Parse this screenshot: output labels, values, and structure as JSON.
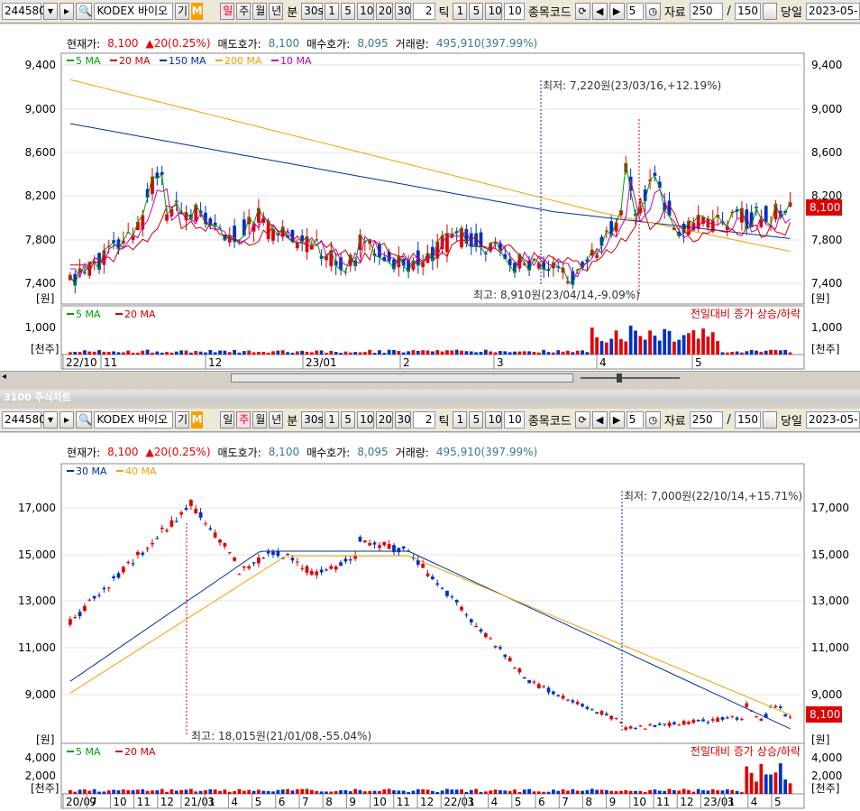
{
  "toolbar": {
    "code": "244580",
    "name": "KODEX 바이오",
    "gi_label": "기",
    "m_label": "M",
    "periods": [
      "일",
      "주",
      "월",
      "년",
      "분",
      "30s",
      "1",
      "5",
      "10",
      "20",
      "30"
    ],
    "tick_count": "2",
    "tick_label": "틱",
    "tick_opts": [
      "1",
      "5",
      "10"
    ],
    "tick_input": "10",
    "code_label": "종목코드",
    "step_value": "5",
    "data_label": "자료",
    "data_count": "250",
    "slash": "/",
    "total": "150",
    "today_label": "당일",
    "date": "2023-05-"
  },
  "info": {
    "price_label": "현재가:",
    "price": "8,100",
    "change": "▲20(0.25%)",
    "ask_label": "매도호가:",
    "ask": "8,100",
    "bid_label": "매수호가:",
    "bid": "8,095",
    "vol_label": "거래량:",
    "vol": "495,910(397.99%)"
  },
  "chart1": {
    "legend": [
      {
        "name": "5 MA",
        "color": "#00a000"
      },
      {
        "name": "20 MA",
        "color": "#d00000"
      },
      {
        "name": "150 MA",
        "color": "#0030a0"
      },
      {
        "name": "200 MA",
        "color": "#f0a000"
      },
      {
        "name": "10 MA",
        "color": "#c000c0"
      }
    ],
    "y_ticks": [
      "9,400",
      "9,000",
      "8,600",
      "8,200",
      "7,800",
      "7,400"
    ],
    "unit": "[원]",
    "low_note": "최저: 7,220원(23/03/16,+12.19%)",
    "high_note": "최고: 8,910원(23/04/14,-9.09%)",
    "price_tag": "8,100",
    "vol_legend": [
      {
        "name": "5 MA",
        "color": "#00a000"
      },
      {
        "name": "20 MA",
        "color": "#d00000"
      }
    ],
    "vol_note": "전일대비 증가 상승/하락",
    "vol_tick": "1,000",
    "vol_unit": "[천주]",
    "x_ticks": [
      "22/10",
      "11",
      "12",
      "23/01",
      "2",
      "3",
      "4",
      "5"
    ]
  },
  "title2": "3100 주식차트",
  "chart2": {
    "legend": [
      {
        "name": "30 MA",
        "color": "#0030a0"
      },
      {
        "name": "40 MA",
        "color": "#f0a000"
      }
    ],
    "y_ticks": [
      "17,000",
      "15,000",
      "13,000",
      "11,000",
      "9,000"
    ],
    "unit": "[원]",
    "low_note": "최저: 7,000원(22/10/14,+15.71%)",
    "high_note": "최고: 18,015원(21/01/08,-55.04%)",
    "price_tag": "8,100",
    "vol_legend": [
      {
        "name": "5 MA",
        "color": "#00a000"
      },
      {
        "name": "20 MA",
        "color": "#d00000"
      }
    ],
    "vol_note": "전일대비 증가 상승/하락",
    "vol_ticks": [
      "4,000",
      "2,000"
    ],
    "vol_unit": "[천주]",
    "x_ticks": [
      "20/07",
      "9",
      "10",
      "11",
      "12",
      "21/01",
      "3",
      "4",
      "5",
      "6",
      "7",
      "8",
      "9",
      "10",
      "11",
      "12",
      "22/01",
      "3",
      "4",
      "5",
      "6",
      "7",
      "8",
      "9",
      "10",
      "11",
      "12",
      "23/01",
      "3",
      "4",
      "5"
    ]
  }
}
